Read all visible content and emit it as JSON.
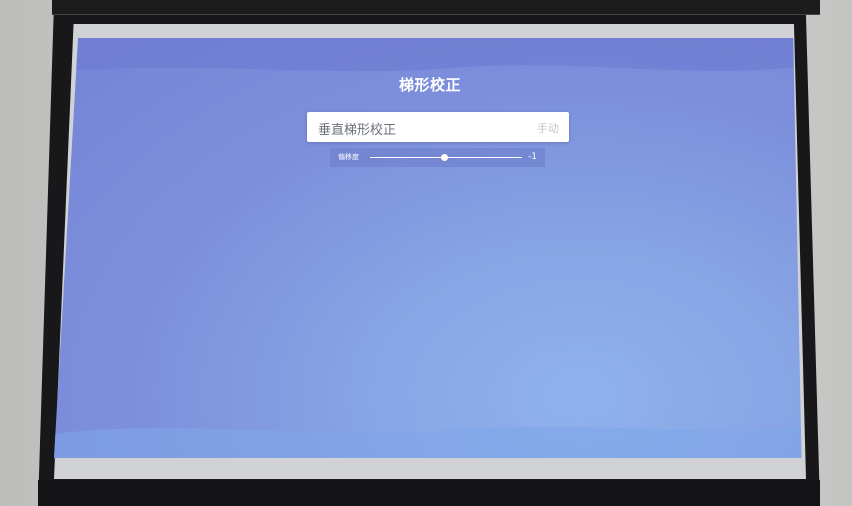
{
  "screen": {
    "title": "梯形校正"
  },
  "menu": {
    "item_label": "垂直梯形校正",
    "item_value": "手动"
  },
  "slider": {
    "label": "偏移度",
    "value": "-1",
    "fraction": 0.49
  },
  "colors": {
    "projection": "#7d8fdc",
    "menu_bg": "#ffffff"
  }
}
